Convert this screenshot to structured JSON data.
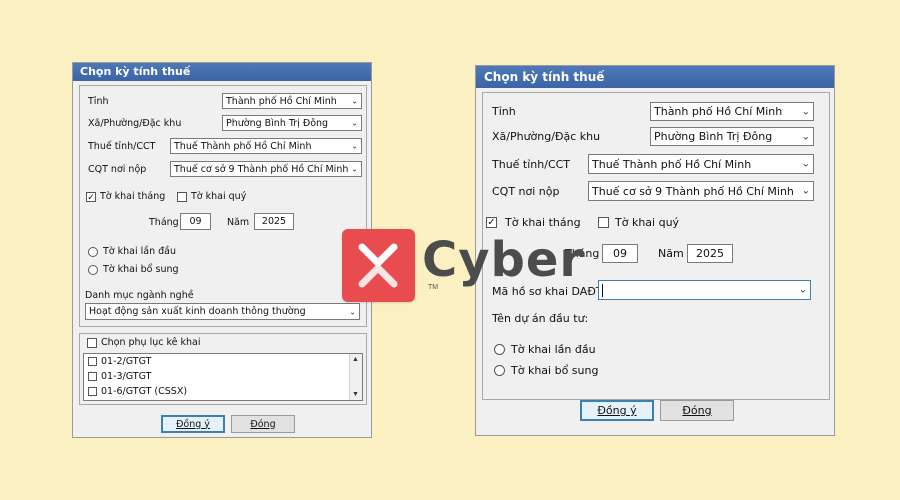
{
  "colors": {
    "background": "#fbf0c2",
    "title_bar": "#4669b0",
    "logo_red": "#e84c4f",
    "logo_text": "#4c4c4c"
  },
  "left_dialog": {
    "title": "Chọn kỳ tính thuế",
    "province_label": "Tỉnh",
    "province_value": "Thành phố Hồ Chí Minh",
    "ward_label": "Xã/Phường/Đặc khu",
    "ward_value": "Phường Bình Trị Đông",
    "tax_dept_label": "Thuế tỉnh/CCT",
    "tax_dept_value": "Thuế Thành phố Hồ Chí Minh",
    "office_label": "CQT nơi nộp",
    "office_value": "Thuế cơ sở 9 Thành phố Hồ Chí Minh",
    "monthly_label": "Tờ khai tháng",
    "monthly_checked": true,
    "quarterly_label": "Tờ khai quý",
    "quarterly_checked": false,
    "month_label": "Tháng",
    "month_value": "09",
    "year_label": "Năm",
    "year_value": "2025",
    "first_label": "Tờ khai lần đầu",
    "supplement_label": "Tờ khai bổ sung",
    "industry_label": "Danh mục ngành nghề",
    "industry_value": "Hoạt động sản xuất kinh doanh thông thường",
    "appendix_label": "Chọn phụ lục kê khai",
    "appendix_items": [
      "01-2/GTGT",
      "01-3/GTGT",
      "01-6/GTGT (CSSX)"
    ],
    "ok_label": "Đồng ý",
    "close_label": "Đóng"
  },
  "right_dialog": {
    "title": "Chọn kỳ tính thuế",
    "province_label": "Tỉnh",
    "province_value": "Thành phố Hồ Chí Minh",
    "ward_label": "Xã/Phường/Đặc khu",
    "ward_value": "Phường Bình Trị Đông",
    "tax_dept_label": "Thuế tỉnh/CCT",
    "tax_dept_value": "Thuế Thành phố Hồ Chí Minh",
    "office_label": "CQT nơi nộp",
    "office_value": "Thuế cơ sở 9 Thành phố Hồ Chí Minh",
    "monthly_label": "Tờ khai tháng",
    "quarterly_label": "Tờ khai quý",
    "month_label": "Tháng",
    "month_value": "09",
    "year_label": "Năm",
    "year_value": "2025",
    "project_code_label": "Mã hồ sơ khai DAĐT",
    "project_code_value": "",
    "project_name_label": "Tên dự án đầu tư:",
    "first_label": "Tờ khai lần đầu",
    "supplement_label": "Tờ khai bổ sung",
    "ok_label": "Đồng ý",
    "close_label": "Đóng"
  },
  "logo": {
    "brand": "Cyber",
    "tm": "TM",
    "icon": "x-mark-icon"
  }
}
